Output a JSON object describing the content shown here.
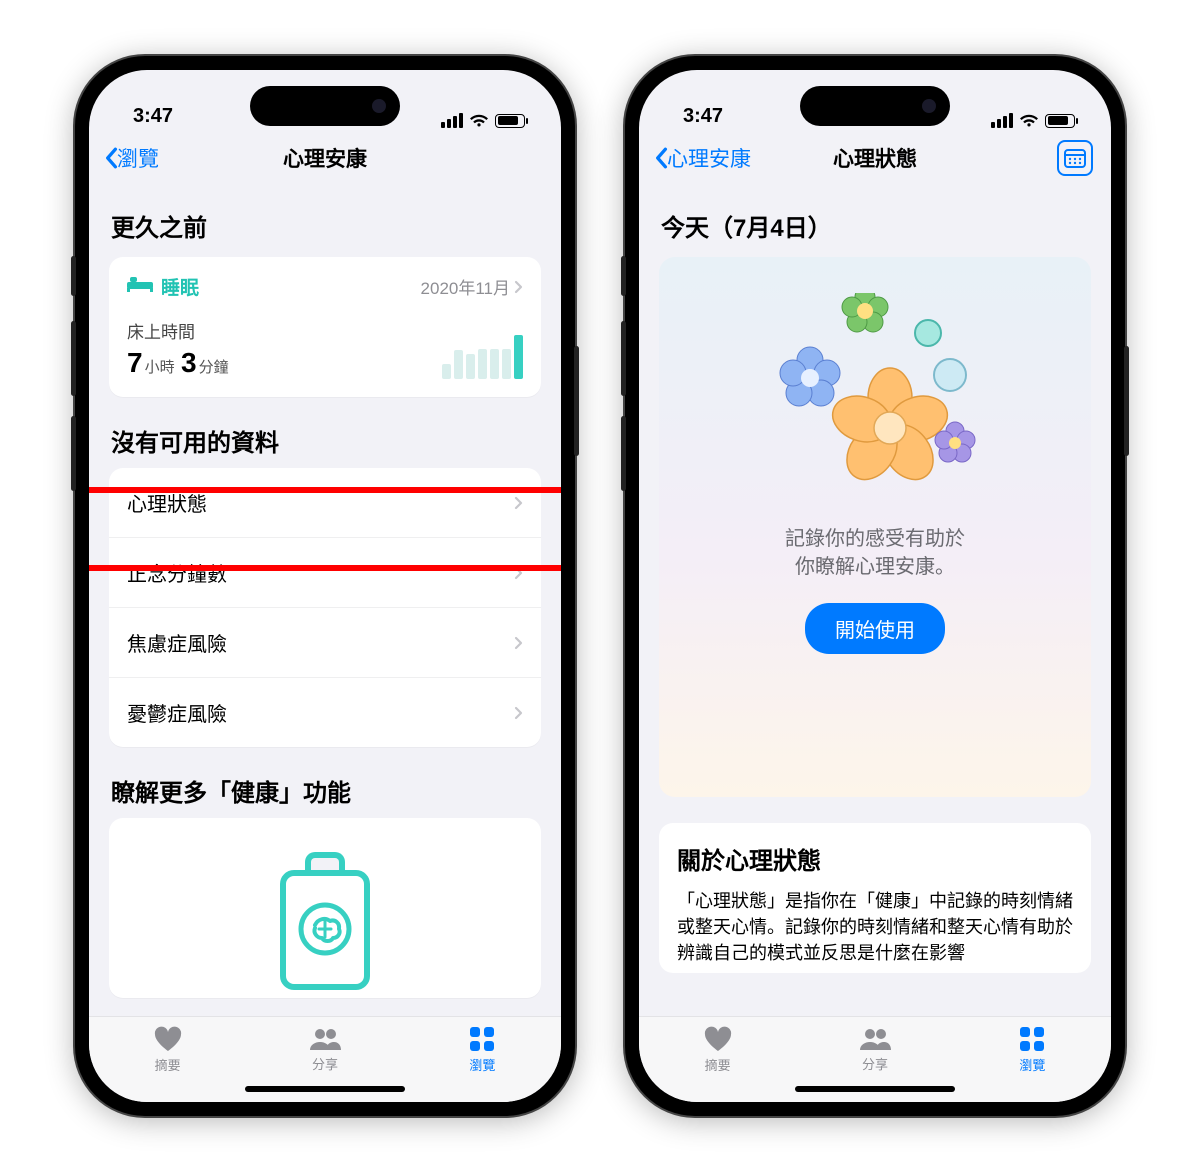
{
  "status": {
    "time": "3:47"
  },
  "left": {
    "back": "瀏覽",
    "title": "心理安康",
    "sec_earlier": "更久之前",
    "sleep": {
      "label": "睡眠",
      "date": "2020年11月",
      "metric_label": "床上時間",
      "hours": "7",
      "hours_unit": "小時",
      "minutes": "3",
      "minutes_unit": "分鐘"
    },
    "no_data_heading": "沒有可用的資料",
    "rows": [
      "心理狀態",
      "正念分鐘數",
      "焦慮症風險",
      "憂鬱症風險"
    ],
    "learn_heading": "瞭解更多「健康」功能"
  },
  "right": {
    "back": "心理安康",
    "title": "心理狀態",
    "today_heading": "今天（7月4日）",
    "desc_line1": "記錄你的感受有助於",
    "desc_line2": "你瞭解心理安康。",
    "cta": "開始使用",
    "about_title": "關於心理狀態",
    "about_text": "「心理狀態」是指你在「健康」中記錄的時刻情緒或整天心情。記錄你的時刻情緒和整天心情有助於辨識自己的模式並反思是什麼在影響"
  },
  "tabs": {
    "summary": "摘要",
    "share": "分享",
    "browse": "瀏覽"
  },
  "colors": {
    "accent": "#007aff",
    "teal": "#37d0c2"
  }
}
